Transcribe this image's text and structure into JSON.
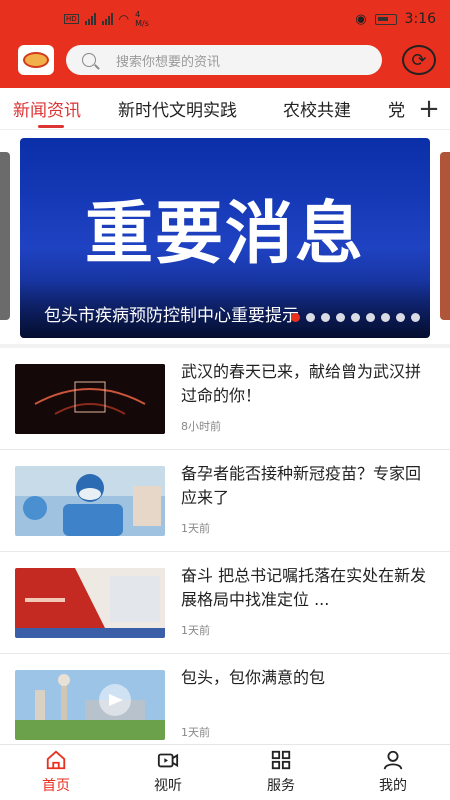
{
  "status": {
    "left": "4G 4G",
    "speed": "4 M/s",
    "time": "3:16"
  },
  "search": {
    "placeholder": "搜索你想要的资讯"
  },
  "tabs": [
    {
      "label": "新闻资讯",
      "active": true
    },
    {
      "label": "新时代文明实践",
      "active": false
    },
    {
      "label": "农校共建",
      "active": false
    },
    {
      "label": "党",
      "active": false
    }
  ],
  "banner": {
    "title": "重要消息",
    "caption": "包头市疾病预防控制中心重要提示"
  },
  "news": [
    {
      "title": "武汉的春天已来，献给曾为武汉拼过命的你！",
      "time": "8小时前"
    },
    {
      "title": "备孕者能否接种新冠疫苗？专家回应来了",
      "time": "1天前"
    },
    {
      "title": "奋斗 把总书记嘱托落在实处在新发展格局中找准定位 ...",
      "time": "1天前"
    },
    {
      "title": "包头，包你满意的包",
      "time": "1天前"
    }
  ],
  "nav": [
    {
      "label": "首页",
      "icon": "home-icon",
      "active": true
    },
    {
      "label": "视听",
      "icon": "video-icon",
      "active": false
    },
    {
      "label": "服务",
      "icon": "grid-icon",
      "active": false
    },
    {
      "label": "我的",
      "icon": "user-icon",
      "active": false
    }
  ],
  "colors": {
    "brand": "#e8301f",
    "active_text": "#dd3333"
  }
}
